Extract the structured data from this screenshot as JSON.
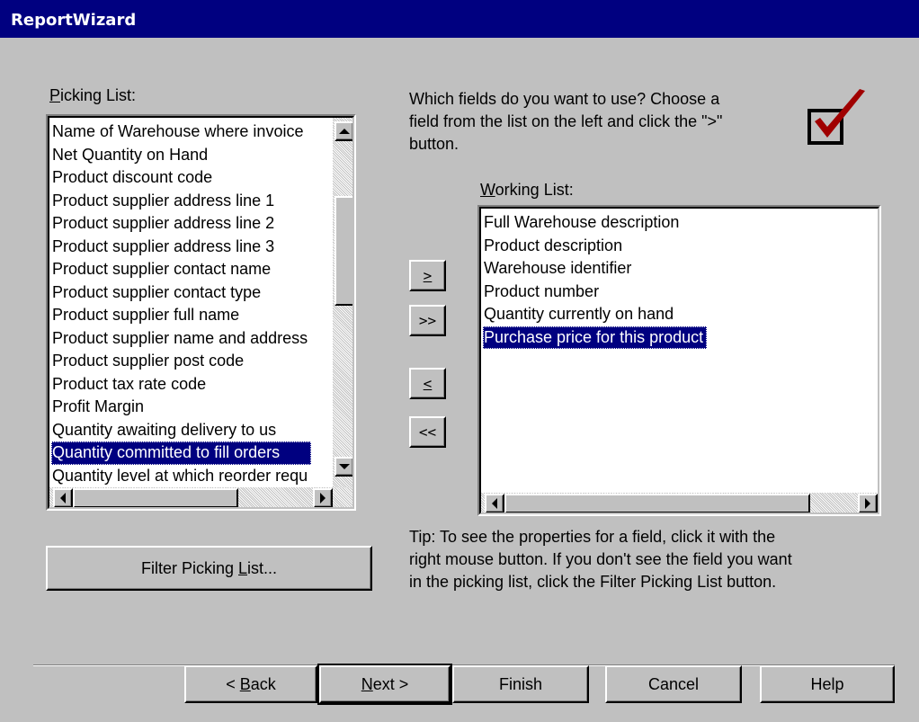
{
  "window": {
    "title": "ReportWizard"
  },
  "picking_list": {
    "label_prefix": "",
    "label_accel": "P",
    "label_rest": "icking List:",
    "items": [
      "Name of Warehouse where invoice",
      "Net Quantity on Hand",
      "Product discount code",
      "Product supplier address line 1",
      "Product supplier address line 2",
      "Product supplier address line 3",
      "Product supplier contact name",
      "Product supplier contact type",
      "Product supplier full name",
      "Product supplier name and address",
      "Product supplier post code",
      "Product tax rate code",
      "Profit Margin",
      "Quantity awaiting delivery to us",
      "Quantity committed to fill orders",
      "Quantity level at which reorder requ"
    ],
    "selected": "Quantity committed to fill orders"
  },
  "instructions": {
    "line1": "Which fields do you want to use?  Choose a",
    "line2": "field from the list on the left and click the \">\"",
    "line3": "button."
  },
  "working_list": {
    "label_accel": "W",
    "label_rest": "orking List:",
    "items": [
      "Full Warehouse description",
      "Product description",
      "Warehouse identifier",
      "Product number",
      "Quantity currently on hand",
      "Purchase price for this product"
    ],
    "selected": "Purchase price for this product"
  },
  "transfer_buttons": {
    "add": ">",
    "add_all": ">>",
    "remove": "<",
    "remove_all": "<<"
  },
  "filter_button": {
    "pre": "Filter Picking ",
    "accel": "L",
    "post": "ist..."
  },
  "tip": {
    "line1": "Tip:  To see the properties for a field, click it with the",
    "line2": "right mouse button.  If you don't see the field you want",
    "line3": "in the picking list, click the Filter Picking List button."
  },
  "footer": {
    "back_pre": "< ",
    "back_accel": "B",
    "back_post": "ack",
    "next_accel": "N",
    "next_post": "ext >",
    "finish": "Finish",
    "cancel": "Cancel",
    "help": "Help"
  },
  "icon": {
    "name": "checkmark-icon",
    "color": "#a00000"
  }
}
